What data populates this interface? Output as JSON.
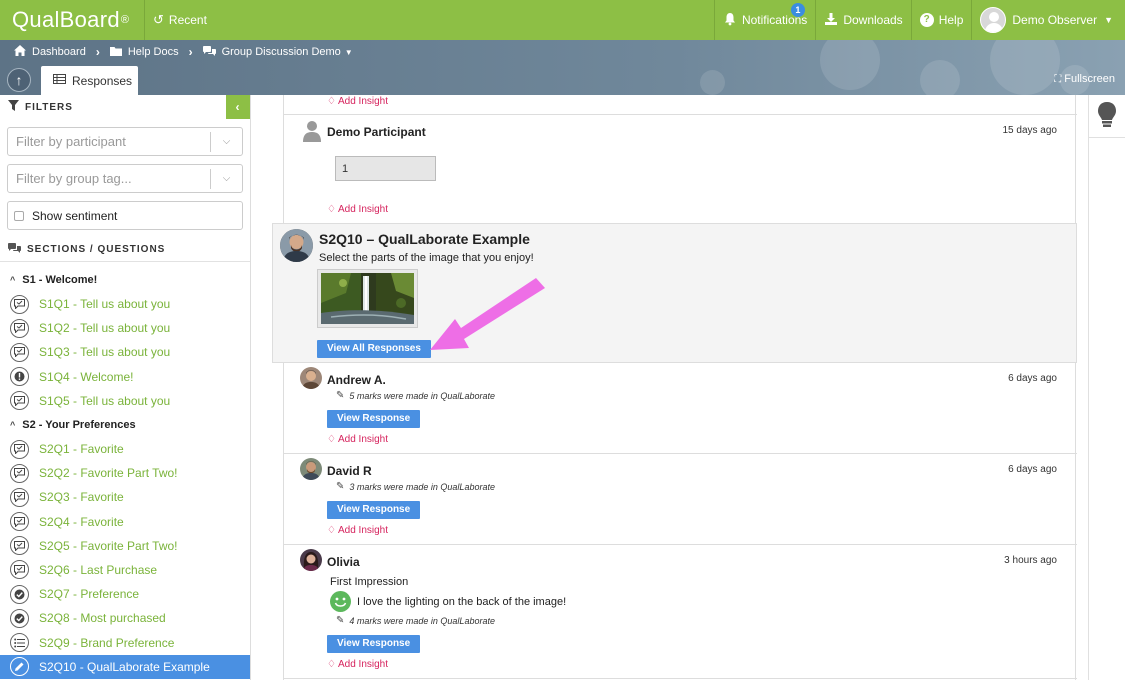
{
  "topbar": {
    "logo": "QualBoard",
    "logo_mark": "®",
    "recent": "Recent",
    "notifications": "Notifications",
    "notifications_count": "1",
    "downloads": "Downloads",
    "help": "Help",
    "user": "Demo Observer"
  },
  "breadcrumb": {
    "dashboard": "Dashboard",
    "help_docs": "Help Docs",
    "group": "Group Discussion Demo"
  },
  "tabs": {
    "responses": "Responses",
    "fullscreen": "Fullscreen"
  },
  "sidebar": {
    "filters_label": "FILTERS",
    "participant_placeholder": "Filter by participant",
    "group_tag_placeholder": "Filter by group tag...",
    "show_sentiment": "Show sentiment",
    "sections_label": "SECTIONS / QUESTIONS",
    "sections": [
      {
        "title": "S1 - Welcome!",
        "items": [
          {
            "label": "S1Q1 - Tell us about you",
            "icon": "chat-icon"
          },
          {
            "label": "S1Q2 - Tell us about you",
            "icon": "chat-icon"
          },
          {
            "label": "S1Q3 - Tell us about you",
            "icon": "chat-icon"
          },
          {
            "label": "S1Q4 - Welcome!",
            "icon": "info-icon"
          },
          {
            "label": "S1Q5 - Tell us about you",
            "icon": "chat-icon"
          }
        ]
      },
      {
        "title": "S2 - Your Preferences",
        "items": [
          {
            "label": "S2Q1 - Favorite",
            "icon": "chat-icon"
          },
          {
            "label": "S2Q2 - Favorite Part Two!",
            "icon": "chat-icon"
          },
          {
            "label": "S2Q3 - Favorite",
            "icon": "chat-icon"
          },
          {
            "label": "S2Q4 - Favorite",
            "icon": "chat-icon"
          },
          {
            "label": "S2Q5 - Favorite Part Two!",
            "icon": "chat-icon"
          },
          {
            "label": "S2Q6 - Last Purchase",
            "icon": "chat-icon"
          },
          {
            "label": "S2Q7 - Preference",
            "icon": "check-icon"
          },
          {
            "label": "S2Q8 - Most purchased",
            "icon": "check-icon"
          },
          {
            "label": "S2Q9 - Brand Preference",
            "icon": "list-icon"
          },
          {
            "label": "S2Q10 - QualLaborate Example",
            "icon": "pencil-icon",
            "active": true
          }
        ]
      }
    ]
  },
  "feed": {
    "add_insight": "Add Insight",
    "demo": {
      "name": "Demo Participant",
      "time": "15 days ago",
      "answer": "1"
    },
    "question": {
      "title": "S2Q10 – QualLaborate Example",
      "prompt": "Select the parts of the image that you enjoy!",
      "view_all": "View All Responses"
    },
    "view_response": "View Response",
    "responses": [
      {
        "name": "Andrew A.",
        "time": "6 days ago",
        "marks": "5 marks were made in QualLaborate"
      },
      {
        "name": "David R",
        "time": "6 days ago",
        "marks": "3 marks were made in QualLaborate"
      },
      {
        "name": "Olivia",
        "time": "3 hours ago",
        "marks": "4 marks were made in QualLaborate",
        "impression_label": "First Impression",
        "impression_text": "I love the lighting on the back of the image!"
      }
    ]
  },
  "colors": {
    "brand_green": "#8dbf45",
    "link_green": "#7ab33a",
    "active_blue": "#4a90e2",
    "insight_pink": "#d6245e",
    "arrow_magenta": "#ee6ee6"
  }
}
